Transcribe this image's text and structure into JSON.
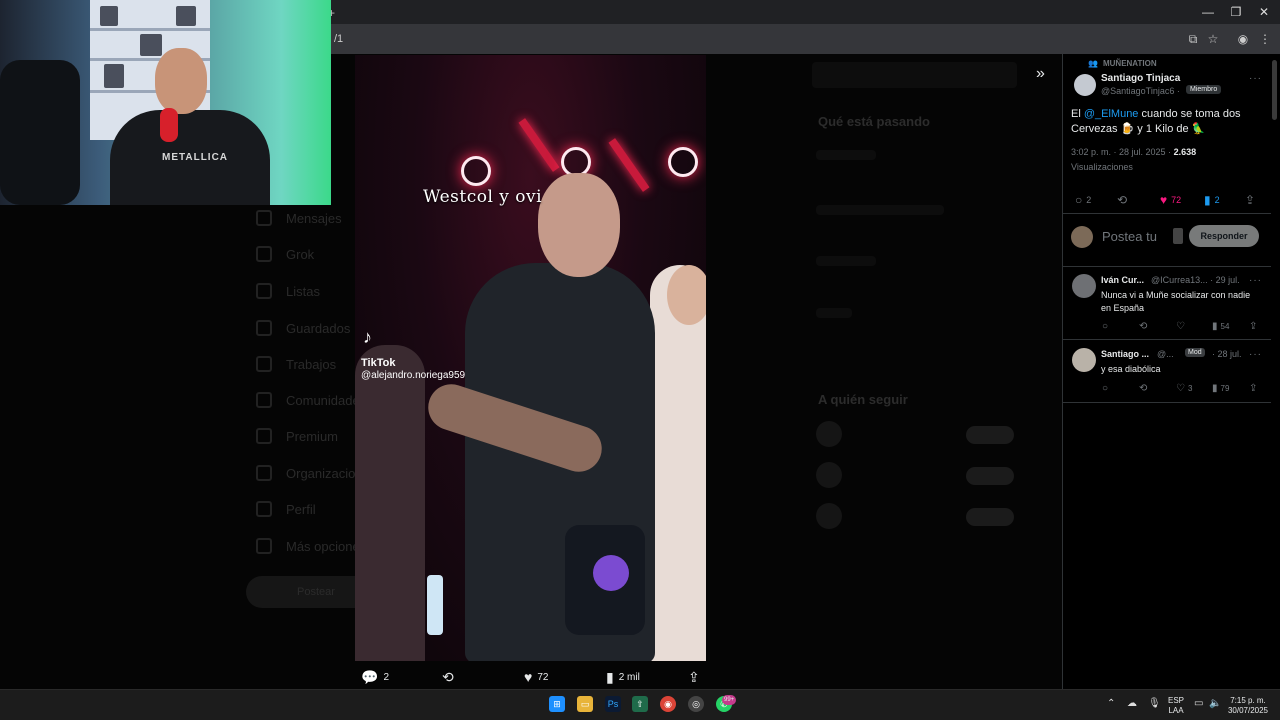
{
  "browser": {
    "url_fragment": "/1",
    "window_min": "—",
    "window_restore": "❐",
    "window_close": "✕"
  },
  "background_page": {
    "nav_items": [
      "Mensajes",
      "Grok",
      "Listas",
      "Guardados",
      "Trabajos",
      "Comunidades",
      "Premium",
      "Organizaciones",
      "Perfil",
      "Más opciones"
    ],
    "post_button": "Postear",
    "trends_heading": "Qué está pasando",
    "follow_heading": "A quién seguir"
  },
  "video": {
    "caption": "Westcol y ovi",
    "tiktok_label": "TikTok",
    "tiktok_handle": "@alejandro.noriega959",
    "actions": {
      "replies": "2",
      "likes": "72",
      "views": "2 mil"
    }
  },
  "webcam": {
    "shirt_text": "METALLICA"
  },
  "post": {
    "community": "MUÑENATION",
    "author_name": "Santiago Tinjaca",
    "author_handle": "@SantiagoTinjac6 ·",
    "member_badge": "Miembro",
    "text_prefix": "El ",
    "mention": "@_ElMune",
    "text_mid": " cuando se toma dos Cervezas 🍺 y 1 Kilo de 🦜",
    "time": "3:02 p. m. · 28 jul. 2025 · ",
    "views_count": "2.638",
    "views_label": "Visualizaciones",
    "stats": {
      "replies": "2",
      "likes": "72",
      "bookmarks": "2"
    },
    "reply_placeholder": "Postea tu",
    "reply_button": "Responder"
  },
  "comments": [
    {
      "name": "Iván Cur...",
      "meta": "@ICurrea13... · 29 jul.",
      "text": "Nunca vi a Muñe socializar con nadie en España",
      "views": "54",
      "likes": ""
    },
    {
      "name": "Santiago ...",
      "meta": "@...",
      "mod_badge": "Mod",
      "date": "· 28 jul.",
      "text": "y esa diabólica",
      "likes": "3",
      "views": "79"
    }
  ],
  "taskbar": {
    "lang_top": "ESP",
    "lang_bottom": "LAA",
    "time": "7:15 p. m.",
    "date": "30/07/2025",
    "whatsapp_badge": "99+"
  }
}
